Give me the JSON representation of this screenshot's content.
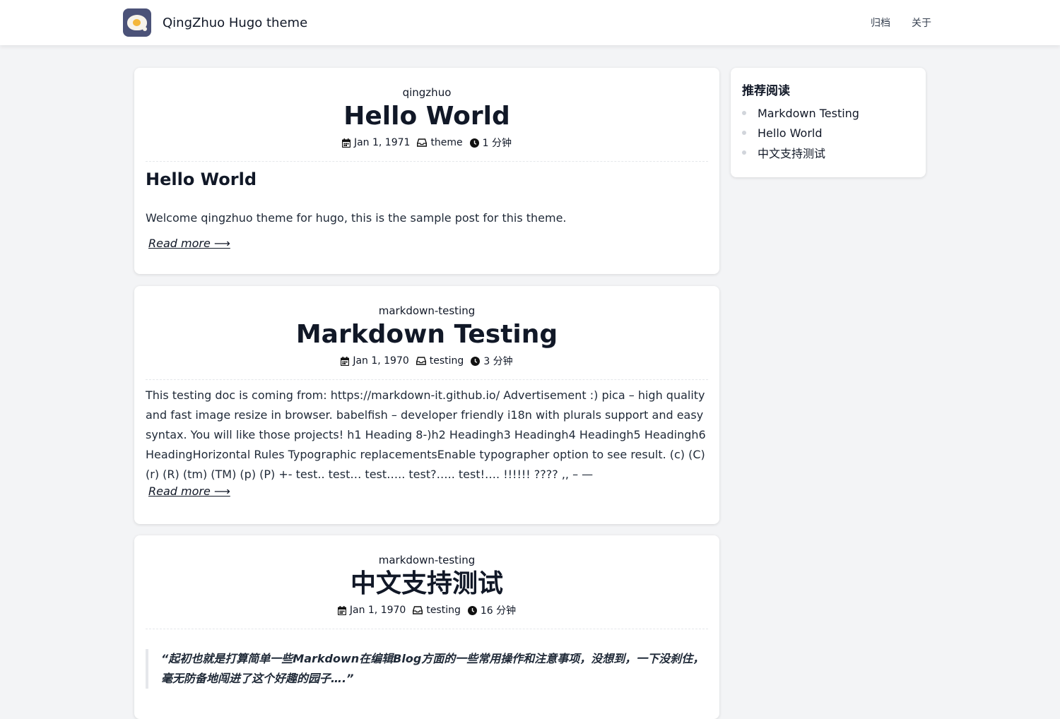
{
  "header": {
    "site_title": "QingZhuo Hugo theme",
    "nav": [
      {
        "label": "归档"
      },
      {
        "label": "关于"
      }
    ]
  },
  "posts": [
    {
      "author": "qingzhuo",
      "title": "Hello World",
      "date": "Jan 1, 1971",
      "category": "theme",
      "reading_time": "1 分钟",
      "heading": "Hello World",
      "excerpt": "Welcome qingzhuo theme for hugo, this is the sample post for this theme.",
      "read_more": "Read more ⟶"
    },
    {
      "author": "markdown-testing",
      "title": "Markdown Testing",
      "date": "Jan 1, 1970",
      "category": "testing",
      "reading_time": "3 分钟",
      "excerpt": "This testing doc is coming from: https://markdown-it.github.io/ Advertisement :) pica – high quality and fast image resize in browser. babelfish – developer friendly i18n with plurals support and easy syntax. You will like those projects! h1 Heading 8-)h2 Headingh3 Headingh4 Headingh5 Headingh6 HeadingHorizontal Rules Typographic replacementsEnable typographer option to see result. (c) (C) (r) (R) (tm) (TM) (p) (P) +- test.. test… test….. test?….. test!…. !!!!!! ???? ,, – —",
      "read_more": "Read more ⟶"
    },
    {
      "author": "markdown-testing",
      "title": "中文支持测试",
      "date": "Jan 1, 1970",
      "category": "testing",
      "reading_time": "16 分钟",
      "quote": "“起初也就是打算简单一些Markdown在编辑Blog方面的一些常用操作和注意事项，没想到，一下没刹住，毫无防备地闯进了这个好趣的园子….”"
    }
  ],
  "sidebar": {
    "title": "推荐阅读",
    "items": [
      {
        "label": "Markdown Testing"
      },
      {
        "label": "Hello World"
      },
      {
        "label": "中文支持测试"
      }
    ]
  }
}
